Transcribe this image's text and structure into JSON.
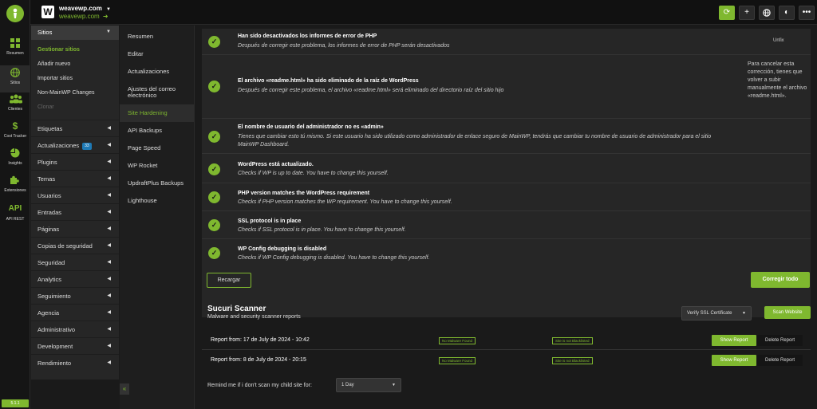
{
  "iconbar": {
    "items": [
      {
        "label": "Resumen",
        "icon": "grid-icon"
      },
      {
        "label": "Sitios",
        "icon": "globe-icon"
      },
      {
        "label": "Clientes",
        "icon": "users-icon"
      },
      {
        "label": "Cost Tracker",
        "icon": "dollar-icon"
      },
      {
        "label": "Insights",
        "icon": "pie-chart-icon"
      },
      {
        "label": "Extensiones",
        "icon": "puzzle-icon"
      },
      {
        "label": "API REST",
        "icon": "API"
      }
    ],
    "version": "5.1.1"
  },
  "topbar": {
    "site_title": "weavewp.com",
    "site_url": "weavewp.com",
    "accent": "#7fb82f"
  },
  "menu1": {
    "header": "Sitios",
    "subitems": [
      "Gestionar sitios",
      "Añadir nuevo",
      "Importar sitios",
      "Non-MainWP Changes",
      "Clonar"
    ],
    "groups": [
      {
        "label": "Etiquetas"
      },
      {
        "label": "Actualizaciones",
        "badge": "33"
      },
      {
        "label": "Plugins"
      },
      {
        "label": "Temas"
      },
      {
        "label": "Usuarios"
      },
      {
        "label": "Entradas"
      },
      {
        "label": "Páginas"
      },
      {
        "label": "Copias de seguridad"
      },
      {
        "label": "Seguridad"
      },
      {
        "label": "Analytics"
      },
      {
        "label": "Seguimiento"
      },
      {
        "label": "Agencia"
      },
      {
        "label": "Administrativo"
      },
      {
        "label": "Development"
      },
      {
        "label": "Rendimiento"
      }
    ]
  },
  "menu2": {
    "items": [
      "Resumen",
      "Editar",
      "Actualizaciones",
      "Ajustes del correo electrónico",
      "Site Hardening",
      "API Backups",
      "Page Speed",
      "WP Rocket",
      "UpdraftPlus Backups",
      "Lighthouse"
    ],
    "active": "Site Hardening"
  },
  "hardening": {
    "rows": [
      {
        "title": "Han sido desactivados los informes de error de PHP",
        "desc": "Después de corregir este problema, los informes de error de PHP serán desactivados",
        "action": "Unfix"
      },
      {
        "title": "El archivo «readme.html» ha sido eliminado de la raíz de WordPress",
        "desc": "Después de corregir este problema, el archivo «readme.html» será eliminado del directorio raíz del sitio hijo",
        "action": "Para cancelar esta corrección, tienes que volver a subir manualmente el archivo «readme.html»."
      },
      {
        "title": "El nombre de usuario del administrador no es «admin»",
        "desc": "Tienes que cambiar esto tú mismo. Si este usuario ha sido utilizado como administrador de enlace seguro de MainWP, tendrás que cambiar tu nombre de usuario de administrador para el sitio MainWP Dashboard.",
        "action": ""
      },
      {
        "title": "WordPress está actualizado.",
        "desc": "Checks if WP is up to date. You have to change this yourself.",
        "action": ""
      },
      {
        "title": "PHP version matches the WordPress requirement",
        "desc": "Checks if PHP version matches the WP requirement. You have to change this yourself.",
        "action": ""
      },
      {
        "title": "SSL protocol is in place",
        "desc": "Checks if SSL protocol is in place. You have to change this yourself.",
        "action": ""
      },
      {
        "title": "WP Config debugging is disabled",
        "desc": "Checks if WP Config debugging is disabled. You have to change this yourself.",
        "action": ""
      }
    ],
    "reload_label": "Recargar",
    "fix_all_label": "Corregir todo"
  },
  "sucuri": {
    "title": "Sucuri Scanner",
    "subtitle": "Malware and security scanner reports",
    "ssl_select": "Verify SSL Certificate",
    "scan_label": "Scan Website",
    "reports": [
      {
        "label": "Report from: 17 de July de 2024 - 10:42",
        "malware": "No Malware Found",
        "blacklist": "Site is not Blacklisted",
        "show": "Show Report",
        "delete": "Delete Report"
      },
      {
        "label": "Report from: 8 de July de 2024 - 20:15",
        "malware": "No Malware Found",
        "blacklist": "Site is not Blacklisted",
        "show": "Show Report",
        "delete": "Delete Report"
      }
    ],
    "remind_label": "Remind me if i don't scan my child site for:",
    "remind_value": "1 Day"
  }
}
